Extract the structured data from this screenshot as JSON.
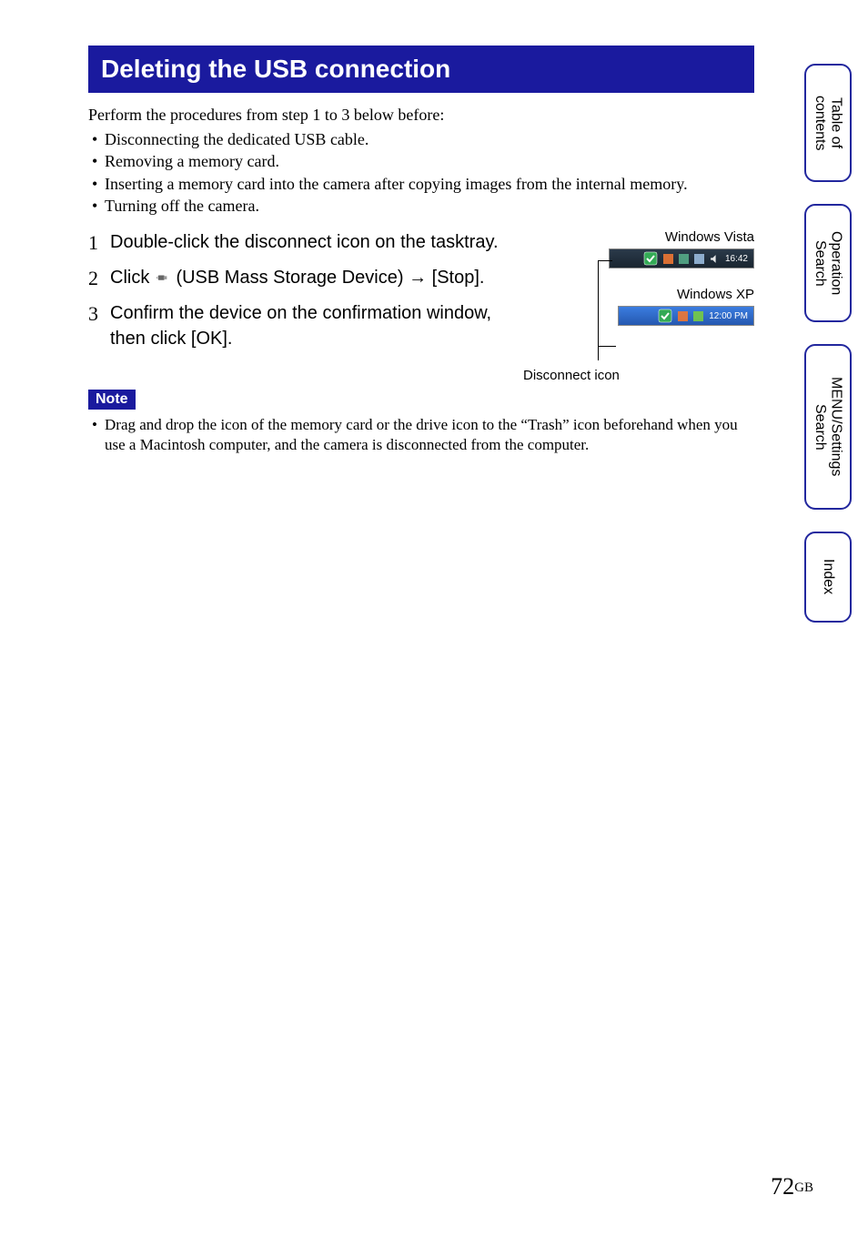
{
  "title": "Deleting the USB connection",
  "intro": "Perform the procedures from step 1 to 3 below before:",
  "intro_bullets": [
    "Disconnecting the dedicated USB cable.",
    "Removing a memory card.",
    "Inserting a memory card into the camera after copying images from the internal memory.",
    "Turning off the camera."
  ],
  "steps": [
    {
      "num": "1",
      "text": "Double-click the disconnect icon on the tasktray."
    },
    {
      "num": "2",
      "prefix": "Click ",
      "mid": " (USB Mass Storage Device) ",
      "arrow": "→",
      "suffix": " [Stop]."
    },
    {
      "num": "3",
      "text": "Confirm the device on the confirmation window, then click [OK]."
    }
  ],
  "illus": {
    "vista_label": "Windows Vista",
    "vista_time": "16:42",
    "xp_label": "Windows XP",
    "xp_time": "12:00 PM",
    "disconnect_label": "Disconnect icon"
  },
  "note_badge": "Note",
  "note_bullets": [
    "Drag and drop the icon of the memory card or the drive icon to the “Trash” icon beforehand when you use a Macintosh computer, and the camera is disconnected from the computer."
  ],
  "tabs": {
    "t1": "Table of\ncontents",
    "t2": "Operation\nSearch",
    "t3": "MENU/Settings\nSearch",
    "t4": "Index"
  },
  "page": {
    "num": "72",
    "suffix": "GB"
  }
}
